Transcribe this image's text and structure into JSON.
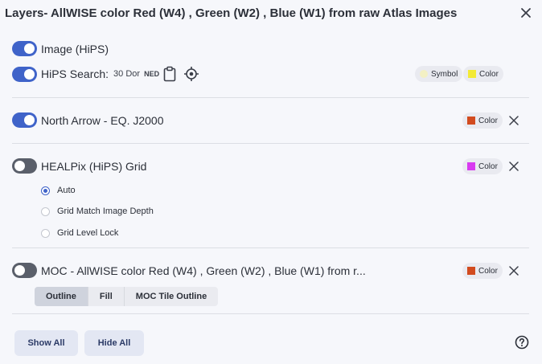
{
  "dialog": {
    "title": "Layers- AllWISE color Red (W4) , Green (W2) , Blue (W1) from raw Atlas Images"
  },
  "layers": {
    "image": {
      "label": "Image (HiPS)",
      "enabled": true
    },
    "hips_search": {
      "label": "HiPS Search:",
      "target": "30 Dor",
      "resolver": "NED",
      "enabled": true,
      "symbol_chip": "Symbol",
      "color_chip": "Color",
      "symbol_color": "#f3f0c4",
      "color_swatch": "#f3ea35"
    },
    "north_arrow": {
      "label": "North Arrow - EQ. J2000",
      "enabled": true,
      "color_chip": "Color",
      "color_swatch": "#d24b1f"
    },
    "healpix_grid": {
      "label": "HEALPix (HiPS) Grid",
      "enabled": false,
      "color_chip": "Color",
      "color_swatch": "#d83af0",
      "options": [
        {
          "label": "Auto",
          "selected": true
        },
        {
          "label": "Grid Match Image Depth",
          "selected": false
        },
        {
          "label": "Grid Level Lock",
          "selected": false
        }
      ]
    },
    "moc": {
      "label": "MOC - AllWISE color Red (W4) , Green (W2) , Blue (W1) from r...",
      "enabled": false,
      "color_chip": "Color",
      "color_swatch": "#d24b1f",
      "styles": [
        {
          "label": "Outline",
          "active": true
        },
        {
          "label": "Fill",
          "active": false
        },
        {
          "label": "MOC Tile Outline",
          "active": false
        }
      ]
    }
  },
  "footer": {
    "show_all": "Show All",
    "hide_all": "Hide All"
  },
  "icons": {
    "close": "close-icon",
    "clipboard": "clipboard-icon",
    "target": "crosshair-icon",
    "help": "help-icon",
    "remove": "close-icon"
  },
  "colors": {
    "accent": "#3f63c9",
    "toggle_off": "#5a5f6a",
    "background": "#f6f7fb"
  }
}
